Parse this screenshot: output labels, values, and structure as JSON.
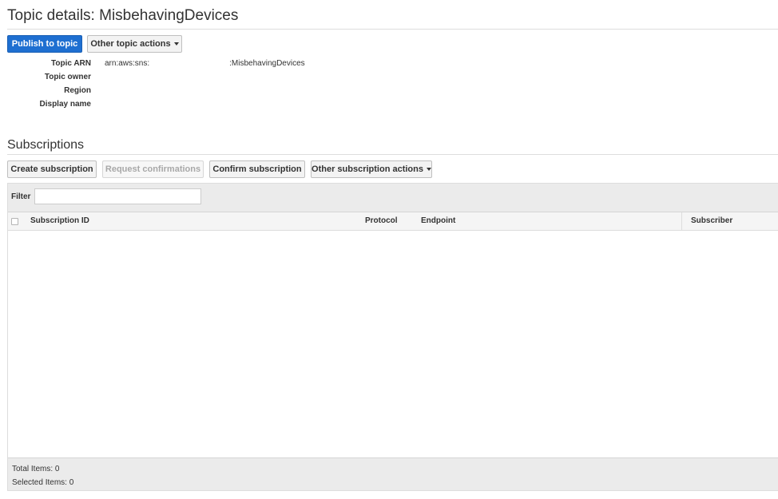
{
  "page": {
    "title": "Topic details: MisbehavingDevices"
  },
  "topic_actions": {
    "publish_label": "Publish to topic",
    "other_actions_label": "Other topic actions"
  },
  "details": [
    {
      "label": "Topic ARN",
      "value": "arn:aws:sns:                                    :MisbehavingDevices"
    },
    {
      "label": "Topic owner",
      "value": ""
    },
    {
      "label": "Region",
      "value": ""
    },
    {
      "label": "Display name",
      "value": ""
    }
  ],
  "subscriptions": {
    "title": "Subscriptions",
    "buttons": {
      "create": "Create subscription",
      "request": "Request confirmations",
      "confirm": "Confirm subscription",
      "other": "Other subscription actions"
    },
    "filter": {
      "label": "Filter",
      "value": "",
      "placeholder": ""
    },
    "columns": [
      "Subscription ID",
      "Protocol",
      "Endpoint",
      "Subscriber"
    ],
    "rows": [],
    "footer": {
      "total": "Total Items: 0",
      "selected": "Selected Items: 0"
    }
  },
  "colors": {
    "primary": "#1e6fd1",
    "toolbar_bg": "#ebebeb"
  }
}
